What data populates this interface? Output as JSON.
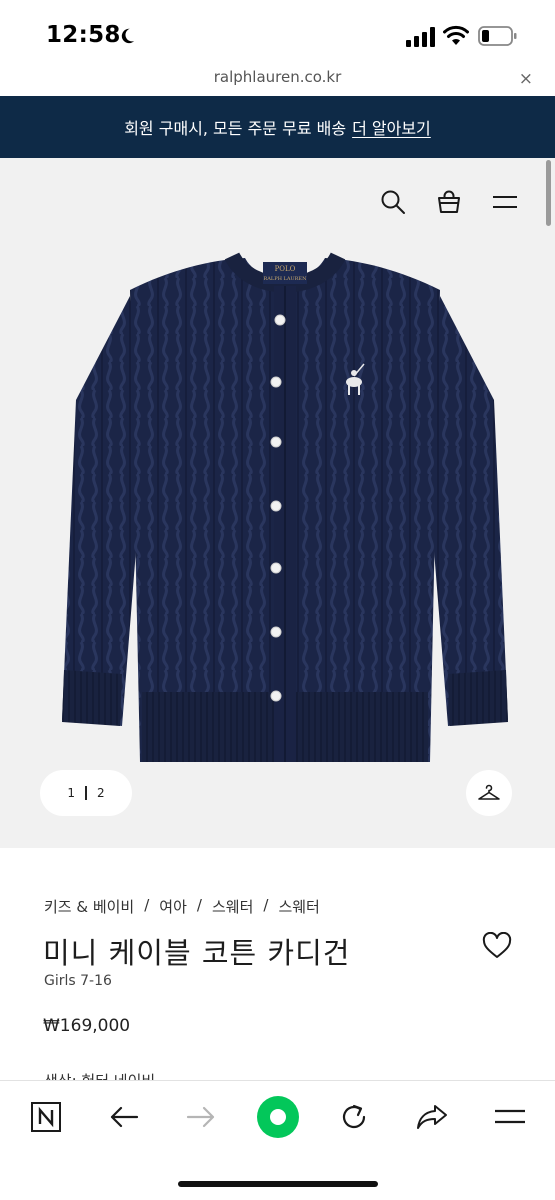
{
  "status_bar": {
    "time": "12:58"
  },
  "browser": {
    "url": "ralphlauren.co.kr",
    "close_glyph": "×"
  },
  "promo": {
    "text": "회원 구매시, 모든 주문 무료 배송",
    "link": "더 알아보기",
    "bg_color": "#0e2a47"
  },
  "header_icons": [
    "search-icon",
    "shopping-bag-icon",
    "menu-icon"
  ],
  "gallery": {
    "pager_current": "1",
    "pager_total": "2"
  },
  "product": {
    "breadcrumb": [
      "키즈 & 베이비",
      "여아",
      "스웨터",
      "스웨터"
    ],
    "breadcrumb_sep": "/",
    "title": "미니 케이블 코튼 카디건",
    "subtitle": "Girls 7-16",
    "price": "₩169,000",
    "color_label": "색상: 헌터 네이비"
  },
  "toolbar": {
    "items": [
      "naver-home-icon",
      "back-arrow-icon",
      "forward-arrow-icon",
      "green-dot-button",
      "reload-icon",
      "share-icon",
      "menu-icon"
    ],
    "accent": "#03c75a"
  }
}
